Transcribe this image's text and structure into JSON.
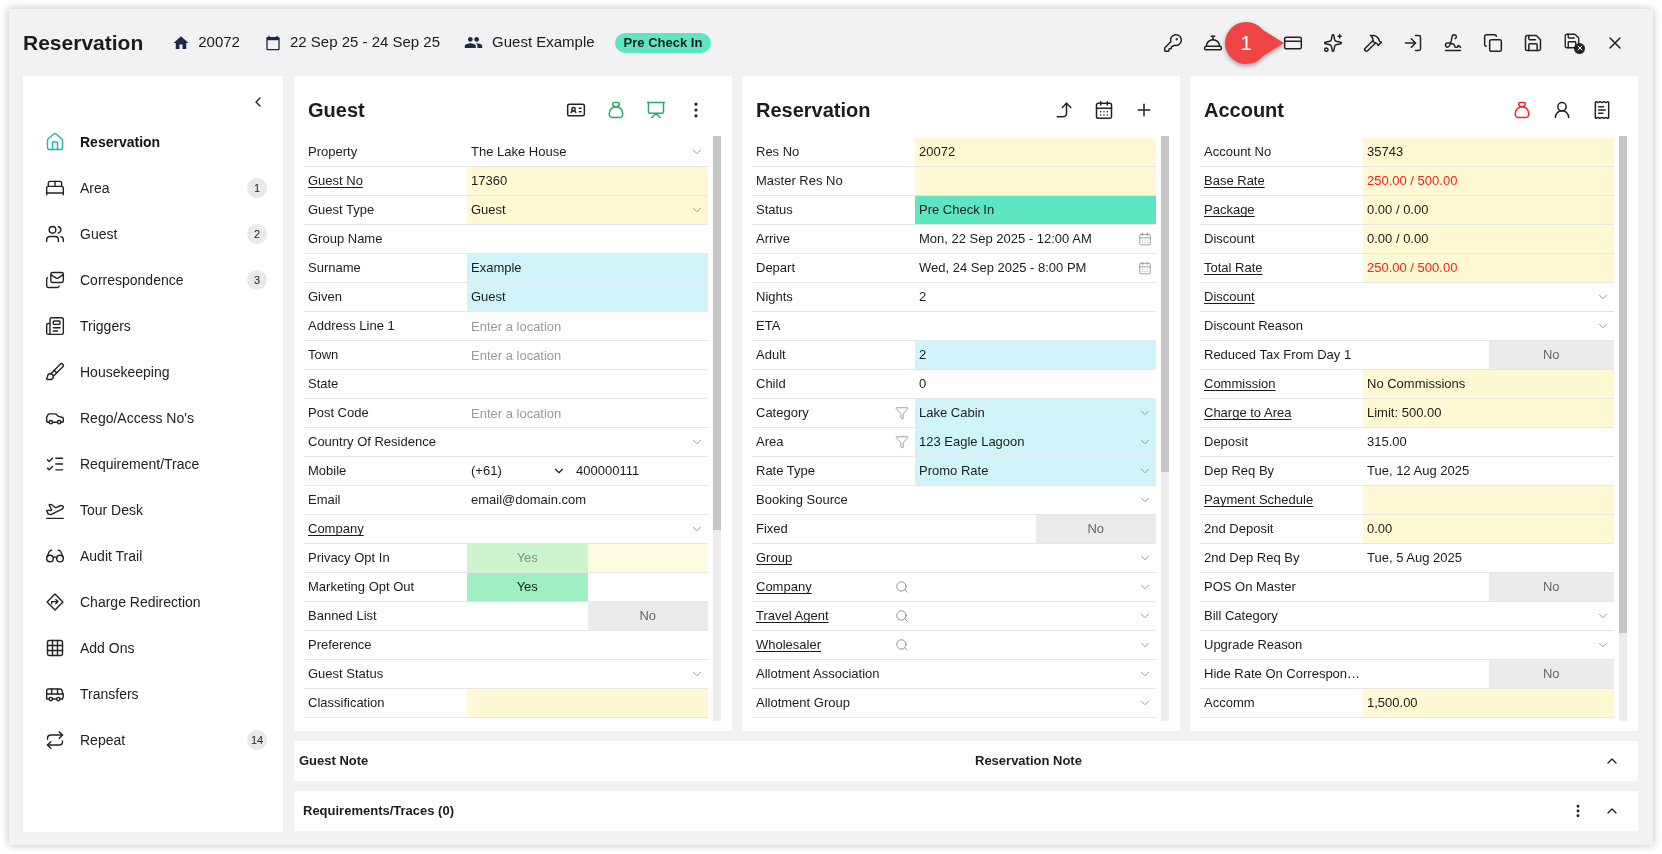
{
  "header": {
    "title": "Reservation",
    "res_no": "20072",
    "dates": "22 Sep 25 - 24 Sep 25",
    "guest": "Guest Example",
    "status": {
      "label": "Pre Check In",
      "color": "#5ee6c2"
    },
    "callout": "1"
  },
  "sidebar": {
    "items": [
      {
        "label": "Reservation",
        "selected": true
      },
      {
        "label": "Area",
        "selected": false,
        "count": "1"
      },
      {
        "label": "Guest",
        "selected": false,
        "count": "2"
      },
      {
        "label": "Correspondence",
        "selected": false,
        "count": "3"
      },
      {
        "label": "Triggers",
        "selected": false
      },
      {
        "label": "Housekeeping",
        "selected": false
      },
      {
        "label": "Rego/Access No's",
        "selected": false
      },
      {
        "label": "Requirement/Trace",
        "selected": false
      },
      {
        "label": "Tour Desk",
        "selected": false
      },
      {
        "label": "Audit Trail",
        "selected": false
      },
      {
        "label": "Charge Redirection",
        "selected": false
      },
      {
        "label": "Add Ons",
        "selected": false
      },
      {
        "label": "Transfers",
        "selected": false
      },
      {
        "label": "Repeat",
        "selected": false,
        "count": "14"
      }
    ]
  },
  "panels": [
    {
      "title": "Guest",
      "rows": [
        {
          "label": "Property",
          "link": false,
          "kind": "select",
          "value": "The Lake House"
        },
        {
          "label": "Guest No",
          "link": true,
          "kind": "text",
          "value": "17360",
          "color": "#fef9d3"
        },
        {
          "label": "Guest Type",
          "link": false,
          "kind": "select",
          "value": "Guest",
          "color": "#fef9d3"
        },
        {
          "label": "Group Name",
          "link": false,
          "kind": "text"
        },
        {
          "label": "Surname",
          "link": false,
          "kind": "text",
          "value": "Example",
          "color": "#cff5fa"
        },
        {
          "label": "Given",
          "link": false,
          "kind": "text",
          "value": "Guest",
          "color": "#cff5fa"
        },
        {
          "label": "Address Line 1",
          "link": false,
          "kind": "text",
          "placeholder": "Enter a location"
        },
        {
          "label": "Town",
          "link": false,
          "kind": "text",
          "placeholder": "Enter a location"
        },
        {
          "label": "State",
          "link": false,
          "kind": "text"
        },
        {
          "label": "Post Code",
          "link": false,
          "kind": "text",
          "placeholder": "Enter a location"
        },
        {
          "label": "Country Of Residence",
          "link": false,
          "kind": "select"
        },
        {
          "label": "Mobile",
          "link": false,
          "kind": "phone",
          "code": "(+61)",
          "value": "400000111"
        },
        {
          "label": "Email",
          "link": false,
          "kind": "text",
          "value": "email@domain.com"
        },
        {
          "label": "Company",
          "link": true,
          "kind": "select"
        },
        {
          "label": "Privacy Opt In",
          "link": false,
          "kind": "toggle",
          "value": "Yes",
          "on": true,
          "disabled": true,
          "color": "#fffbe3"
        },
        {
          "label": "Marketing Opt Out",
          "link": false,
          "kind": "toggle",
          "value": "Yes",
          "on": true,
          "disabled": false
        },
        {
          "label": "Banned List",
          "link": false,
          "kind": "toggle",
          "value": "No",
          "on": false,
          "disabled": false
        },
        {
          "label": "Preference",
          "link": false,
          "kind": "text"
        },
        {
          "label": "Guest Status",
          "link": false,
          "kind": "select"
        },
        {
          "label": "Classification",
          "link": false,
          "kind": "text",
          "color": "#fef9d3"
        }
      ]
    },
    {
      "title": "Reservation",
      "rows": [
        {
          "label": "Res No",
          "link": false,
          "kind": "text",
          "value": "20072",
          "color": "#fef9d3"
        },
        {
          "label": "Master Res No",
          "link": false,
          "kind": "text",
          "color": "#fef9d3"
        },
        {
          "label": "Status",
          "link": false,
          "kind": "text",
          "value": "Pre Check In",
          "color": "#5ee6c2"
        },
        {
          "label": "Arrive",
          "link": false,
          "kind": "date",
          "value": "Mon, 22 Sep 2025 - 12:00 AM"
        },
        {
          "label": "Depart",
          "link": false,
          "kind": "date",
          "value": "Wed, 24 Sep 2025 - 8:00 PM"
        },
        {
          "label": "Nights",
          "link": false,
          "kind": "text",
          "value": "2"
        },
        {
          "label": "ETA",
          "link": false,
          "kind": "text"
        },
        {
          "label": "Adult",
          "link": false,
          "kind": "text",
          "value": "2",
          "color": "#cff5fa"
        },
        {
          "label": "Child",
          "link": false,
          "kind": "text",
          "value": "0"
        },
        {
          "label": "Category",
          "link": false,
          "kind": "filter-select",
          "value": "Lake Cabin",
          "color": "#cff5fa"
        },
        {
          "label": "Area",
          "link": false,
          "kind": "filter-select",
          "value": "123 Eagle Lagoon",
          "color": "#cff5fa"
        },
        {
          "label": "Rate Type",
          "link": false,
          "kind": "select",
          "value": "Promo Rate",
          "color": "#cff5fa"
        },
        {
          "label": "Booking Source",
          "link": false,
          "kind": "select"
        },
        {
          "label": "Fixed",
          "link": false,
          "kind": "toggle",
          "value": "No",
          "on": false,
          "disabled": false
        },
        {
          "label": "Group",
          "link": true,
          "kind": "select"
        },
        {
          "label": "Company",
          "link": true,
          "kind": "lookup"
        },
        {
          "label": "Travel Agent",
          "link": true,
          "kind": "lookup"
        },
        {
          "label": "Wholesaler",
          "link": true,
          "kind": "lookup"
        },
        {
          "label": "Allotment Association",
          "link": false,
          "kind": "select"
        },
        {
          "label": "Allotment Group",
          "link": false,
          "kind": "select"
        }
      ]
    },
    {
      "title": "Account",
      "rows": [
        {
          "label": "Account No",
          "link": false,
          "kind": "text",
          "value": "35743",
          "color": "#fef9d3"
        },
        {
          "label": "Base Rate",
          "link": true,
          "alert": true,
          "kind": "text",
          "value": "250.00 / 500.00",
          "color": "#fef9d3"
        },
        {
          "label": "Package",
          "link": true,
          "kind": "text",
          "value": "0.00 / 0.00",
          "color": "#fef9d3"
        },
        {
          "label": "Discount",
          "link": false,
          "kind": "text",
          "value": "0.00 / 0.00",
          "color": "#fef9d3"
        },
        {
          "label": "Total Rate",
          "link": true,
          "alert": true,
          "kind": "text",
          "value": "250.00 / 500.00",
          "color": "#fef9d3"
        },
        {
          "label": "Discount",
          "link": true,
          "kind": "select"
        },
        {
          "label": "Discount Reason",
          "link": false,
          "kind": "select"
        },
        {
          "label": "Reduced Tax From Day 1",
          "link": false,
          "kind": "toggle",
          "value": "No",
          "on": false,
          "disabled": false
        },
        {
          "label": "Commission",
          "link": true,
          "kind": "text",
          "value": "No Commissions",
          "color": "#fef9d3"
        },
        {
          "label": "Charge to Area",
          "link": true,
          "kind": "text",
          "value": "Limit: 500.00",
          "color": "#fef9d3"
        },
        {
          "label": "Deposit",
          "link": false,
          "kind": "text",
          "value": "315.00"
        },
        {
          "label": "Dep Req By",
          "link": false,
          "kind": "text",
          "value": "Tue, 12 Aug 2025"
        },
        {
          "label": "Payment Schedule",
          "link": true,
          "kind": "text",
          "color": "#fef9d3"
        },
        {
          "label": "2nd Deposit",
          "link": false,
          "kind": "text",
          "value": "0.00",
          "color": "#fef9d3"
        },
        {
          "label": "2nd Dep Req By",
          "link": false,
          "kind": "text",
          "value": "Tue, 5 Aug 2025"
        },
        {
          "label": "POS On Master",
          "link": false,
          "kind": "toggle",
          "value": "No",
          "on": false,
          "disabled": false
        },
        {
          "label": "Bill Category",
          "link": false,
          "kind": "select"
        },
        {
          "label": "Upgrade Reason",
          "link": false,
          "kind": "select"
        },
        {
          "label": "Hide Rate On Correspon…",
          "link": false,
          "kind": "toggle",
          "value": "No",
          "on": false,
          "disabled": false
        },
        {
          "label": "Accomm",
          "link": false,
          "kind": "text",
          "value": "1,500.00",
          "color": "#fef9d3"
        }
      ]
    }
  ],
  "notes_bar": {
    "guest_note": "Guest Note",
    "reservation_note": "Reservation Note"
  },
  "requirements_bar": {
    "title": "Requirements/Traces (0)"
  }
}
